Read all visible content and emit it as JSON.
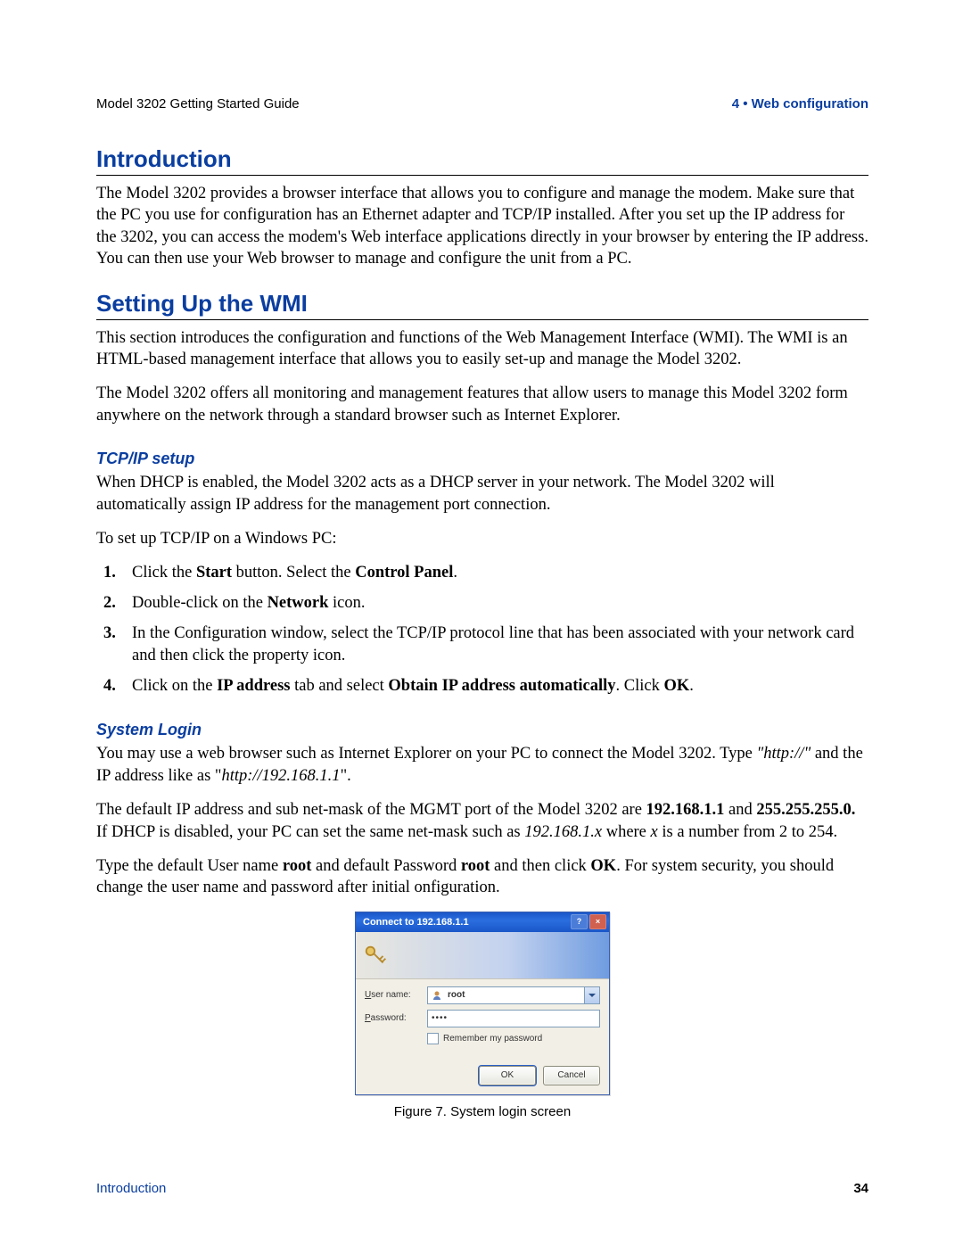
{
  "header": {
    "left": "Model 3202 Getting Started Guide",
    "right": "4 • Web configuration"
  },
  "sections": {
    "intro": {
      "title": "Introduction",
      "p1": "The Model 3202 provides a browser interface that allows you to configure and manage the modem. Make sure that the PC you use for configuration has an Ethernet adapter and TCP/IP installed. After you set up the IP address for the 3202, you can access the modem's Web interface applications directly in your browser by entering the IP address. You can then use your Web browser to manage and configure the unit from a PC."
    },
    "wmi": {
      "title": "Setting Up the WMI",
      "p1": "This section introduces the configuration and functions of the Web Management Interface (WMI). The WMI is an HTML-based management interface that allows you to easily set-up and manage the Model 3202.",
      "p2": "The Model 3202 offers all monitoring and management features that allow users to manage this Model 3202 form anywhere on the network through a standard browser such as Internet Explorer."
    },
    "tcpip": {
      "title": "TCP/IP setup",
      "p1": "When DHCP is enabled, the Model 3202 acts as a DHCP server in your network. The Model 3202 will automatically assign IP address for the management port connection.",
      "p2": "To set up TCP/IP on a Windows PC:",
      "steps": {
        "s1a": "Click the ",
        "s1b": "Start",
        "s1c": " button. Select the ",
        "s1d": "Control Panel",
        "s1e": ".",
        "s2a": "Double-click on the ",
        "s2b": "Network",
        "s2c": " icon.",
        "s3": "In the Configuration window, select the TCP/IP protocol line that has been associated with your network card and then click the property icon.",
        "s4a": "Click on the ",
        "s4b": "IP address",
        "s4c": " tab and select ",
        "s4d": "Obtain IP address automatically",
        "s4e": ". Click ",
        "s4f": "OK",
        "s4g": "."
      }
    },
    "login": {
      "title": "System Login",
      "p1a": "You may use a web browser such as Internet Explorer on your PC to connect the Model 3202. Type ",
      "p1b": "\"http://\"",
      "p1c": " and the IP address like as \"",
      "p1d": "http://192.168.1.1",
      "p1e": "\".",
      "p2a": "The default IP address and sub net-mask of the MGMT port of the Model 3202 are ",
      "p2b": "192.168.1.1",
      "p2c": " and ",
      "p2d": "255.255.255.0.",
      "p2e": " If DHCP is disabled, your PC can set the same net-mask such as ",
      "p2f": "192.168.1.x",
      "p2g": " where ",
      "p2h": "x",
      "p2i": " is a number from 2 to 254.",
      "p3a": "Type the default User name ",
      "p3b": "root",
      "p3c": " and default Password ",
      "p3d": "root",
      "p3e": " and then click ",
      "p3f": "OK",
      "p3g": ". For system security, you should change the user name and password after initial onfiguration."
    }
  },
  "dialog": {
    "title": "Connect to 192.168.1.1",
    "user_label_pre": "U",
    "user_label_rest": "ser name:",
    "pass_label_pre": "P",
    "pass_label_rest": "assword:",
    "username": "root",
    "password_mask": "••••",
    "remember_pre": "R",
    "remember_rest": "emember my password",
    "ok": "OK",
    "cancel": "Cancel",
    "help_glyph": "?",
    "close_glyph": "×"
  },
  "figure_caption": "Figure 7. System login screen",
  "footer": {
    "left": "Introduction",
    "right": "34"
  }
}
